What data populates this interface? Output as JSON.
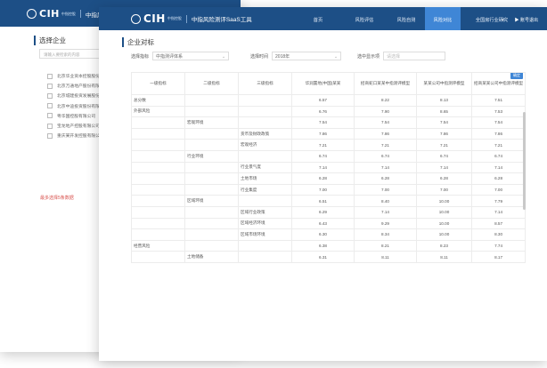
{
  "back_window": {
    "logo_text": "CIH",
    "logo_sub": "中指控股",
    "app_name": "中指风险测评",
    "section_title": "选择企业",
    "search_placeholder": "请输入要检索的内容",
    "companies": [
      "北京华业资本控股股份有限公司",
      "北京万通地产股份有限公司",
      "北京城建投资发展股份有限公司",
      "北京中迪投资股份有限公司",
      "粤华国控股有限公司",
      "宝龙地产控股有限公司",
      "重庆某开发控股有限公司"
    ],
    "selected_count": "最多选择5条数据"
  },
  "front_window": {
    "logo_text": "CIH",
    "logo_sub": "中指控股",
    "app_name": "中指风险测评SaaS工具",
    "nav": [
      {
        "label": "首页",
        "active": false
      },
      {
        "label": "风险评估",
        "active": false
      },
      {
        "label": "风险自测",
        "active": false
      },
      {
        "label": "风险对比",
        "active": true
      },
      {
        "label": "全国房行业研究",
        "active": false
      }
    ],
    "user_menu": "▾",
    "logout": "▶ 账号退出",
    "page_title": "企业对标",
    "filters": {
      "index_label": "选择指标",
      "index_value": "中指测评体系",
      "period_label": "选择时间",
      "period_value": "2018年",
      "enterprise_label": "选中显示项",
      "enterprise_placeholder": "请选择"
    },
    "export_label": "确定",
    "table": {
      "headers": [
        "一级指标",
        "二级指标",
        "三级指标",
        "华润置地(中国)某某",
        "招商蛇口某某中指测评模型",
        "某某公司中指测评模型",
        "招商某某公司中指测评模型"
      ],
      "rows": [
        {
          "l1": "总分数",
          "l2": "",
          "l3": "",
          "v": [
            "6.57",
            "8.22",
            "8.13",
            "7.51"
          ]
        },
        {
          "l1": "外部风险",
          "l2": "",
          "l3": "",
          "v": [
            "6.76",
            "7.90",
            "8.65",
            "7.53"
          ]
        },
        {
          "l1": "",
          "l2": "宏观环境",
          "l3": "",
          "v": [
            "7.54",
            "7.54",
            "7.54",
            "7.54"
          ]
        },
        {
          "l1": "",
          "l2": "",
          "l3": "货币及财政政策",
          "v": [
            "7.86",
            "7.86",
            "7.86",
            "7.86"
          ]
        },
        {
          "l1": "",
          "l2": "",
          "l3": "宏观经济",
          "v": [
            "7.21",
            "7.21",
            "7.21",
            "7.21"
          ]
        },
        {
          "l1": "",
          "l2": "行业环境",
          "l3": "",
          "v": [
            "6.74",
            "6.74",
            "6.74",
            "6.74"
          ]
        },
        {
          "l1": "",
          "l2": "",
          "l3": "行业景气度",
          "v": [
            "7.14",
            "7.14",
            "7.14",
            "7.14"
          ]
        },
        {
          "l1": "",
          "l2": "",
          "l3": "土地市场",
          "v": [
            "6.28",
            "6.28",
            "6.28",
            "6.28"
          ]
        },
        {
          "l1": "",
          "l2": "",
          "l3": "行业集度",
          "v": [
            "7.00",
            "7.00",
            "7.00",
            "7.00"
          ]
        },
        {
          "l1": "",
          "l2": "区域环境",
          "l3": "",
          "v": [
            "6.51",
            "8.40",
            "10.00",
            "7.79"
          ]
        },
        {
          "l1": "",
          "l2": "",
          "l3": "区域行业政策",
          "v": [
            "6.29",
            "7.14",
            "10.00",
            "7.14"
          ]
        },
        {
          "l1": "",
          "l2": "",
          "l3": "区域经济环境",
          "v": [
            "6.43",
            "9.29",
            "10.00",
            "8.57"
          ]
        },
        {
          "l1": "",
          "l2": "",
          "l3": "区域市场环境",
          "v": [
            "6.30",
            "8.34",
            "10.00",
            "8.30"
          ]
        },
        {
          "l1": "经营风险",
          "l2": "",
          "l3": "",
          "v": [
            "6.38",
            "8.21",
            "8.23",
            "7.74"
          ]
        },
        {
          "l1": "",
          "l2": "土地储备",
          "l3": "",
          "v": [
            "6.31",
            "8.11",
            "8.11",
            "8.17"
          ]
        }
      ]
    }
  }
}
